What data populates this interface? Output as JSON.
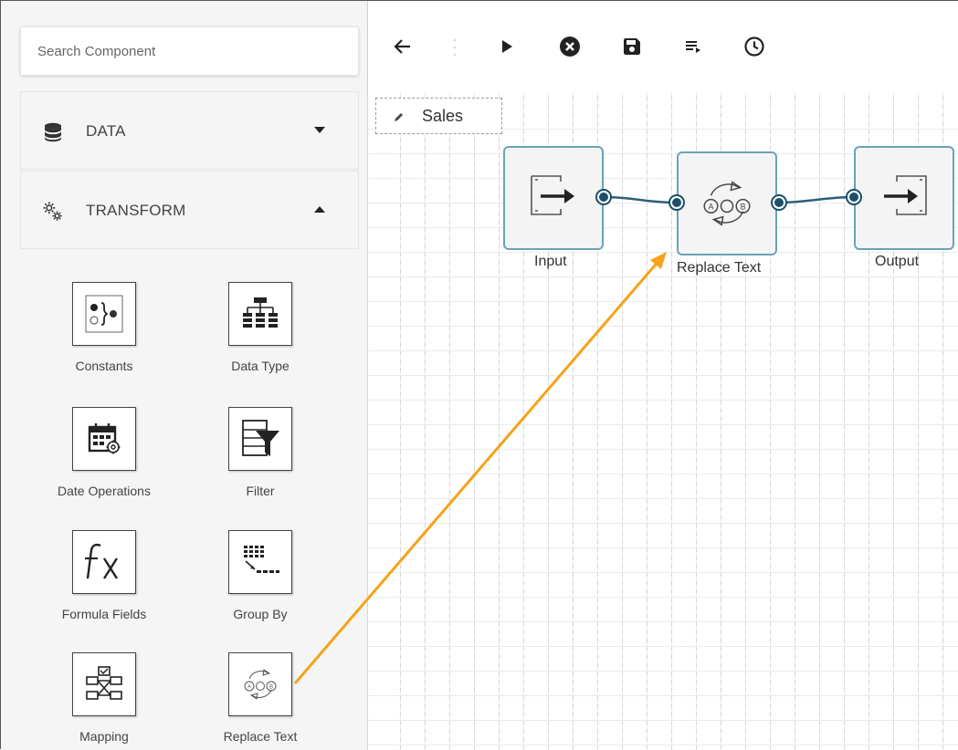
{
  "sidebar": {
    "search": {
      "placeholder": "Search Component"
    },
    "sections": [
      {
        "label": "DATA",
        "icon": "database-icon",
        "state": "collapsed"
      },
      {
        "label": "TRANSFORM",
        "icon": "gears-icon",
        "state": "expanded"
      }
    ],
    "components": [
      {
        "label": "Constants",
        "icon": "constants-icon"
      },
      {
        "label": "Data Type",
        "icon": "data-type-icon"
      },
      {
        "label": "Date Operations",
        "icon": "date-operations-icon"
      },
      {
        "label": "Filter",
        "icon": "filter-icon"
      },
      {
        "label": "Formula Fields",
        "icon": "formula-fields-icon"
      },
      {
        "label": "Group By",
        "icon": "group-by-icon"
      },
      {
        "label": "Mapping",
        "icon": "mapping-icon"
      },
      {
        "label": "Replace Text",
        "icon": "replace-text-icon"
      }
    ]
  },
  "toolbar": {
    "buttons": [
      "back-arrow-icon",
      "more-vertical-icon",
      "play-icon",
      "stop-icon",
      "save-icon",
      "playlist-icon",
      "history-clock-icon"
    ]
  },
  "canvas": {
    "flow_name": "Sales",
    "nodes": [
      {
        "label": "Input",
        "icon": "input-icon"
      },
      {
        "label": "Replace Text",
        "icon": "replace-text-icon"
      },
      {
        "label": "Output",
        "icon": "output-icon"
      }
    ]
  },
  "colors": {
    "node_border": "#6aa3b5",
    "port": "#1b4f69",
    "link": "#2b5f78",
    "drag_arrow": "#f6a21b",
    "icon": "#222222"
  }
}
